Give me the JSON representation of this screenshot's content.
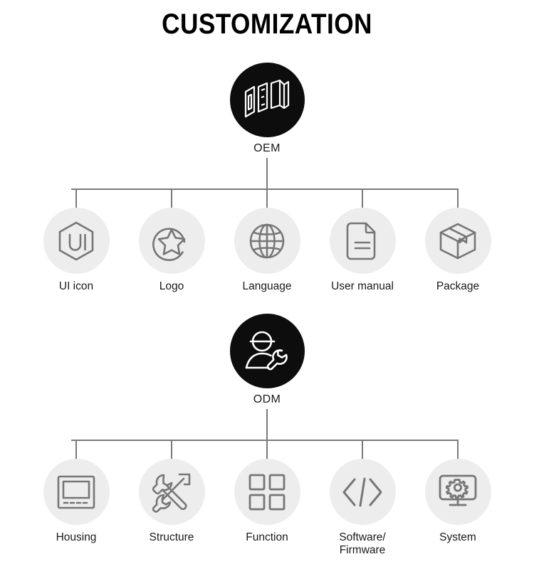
{
  "title": "CUSTOMIZATION",
  "colors": {
    "root_circle": "#0d0d0d",
    "leaf_circle": "#ededed",
    "icon_stroke": "#767676",
    "connector": "#7a7a7a",
    "label_text": "#1a1a1a",
    "background": "#ffffff"
  },
  "groups": [
    {
      "root": {
        "label": "OEM",
        "icon": "oem-3d-text-icon"
      },
      "children": [
        {
          "label": "UI icon",
          "icon": "hexagon-ui-icon"
        },
        {
          "label": "Logo",
          "icon": "star-circle-icon"
        },
        {
          "label": "Language",
          "icon": "globe-icon"
        },
        {
          "label": "User manual",
          "icon": "document-lines-icon"
        },
        {
          "label": "Package",
          "icon": "box-3d-icon"
        }
      ]
    },
    {
      "root": {
        "label": "ODM",
        "icon": "engineer-wrench-icon"
      },
      "children": [
        {
          "label": "Housing",
          "icon": "device-panel-icon"
        },
        {
          "label": "Structure",
          "icon": "wrench-screwdriver-icon"
        },
        {
          "label": "Function",
          "icon": "grid-four-squares-icon"
        },
        {
          "label": "Software/\nFirmware",
          "icon": "code-brackets-icon"
        },
        {
          "label": "System",
          "icon": "monitor-gear-icon"
        }
      ]
    }
  ]
}
